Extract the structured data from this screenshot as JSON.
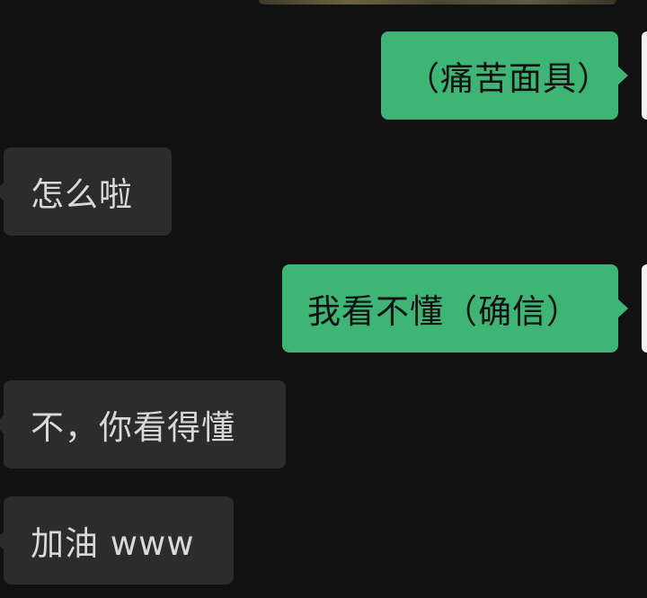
{
  "messages": [
    {
      "direction": "outgoing",
      "text": "（痛苦面具）"
    },
    {
      "direction": "incoming",
      "text": "怎么啦"
    },
    {
      "direction": "outgoing",
      "text": "我看不懂（确信）"
    },
    {
      "direction": "incoming",
      "text": "不，你看得懂"
    },
    {
      "direction": "incoming",
      "text": "加油 www"
    }
  ],
  "colors": {
    "background": "#111111",
    "outgoing_bubble": "#3eb575",
    "incoming_bubble": "#2c2c2c",
    "incoming_text": "#d9d9d9"
  }
}
